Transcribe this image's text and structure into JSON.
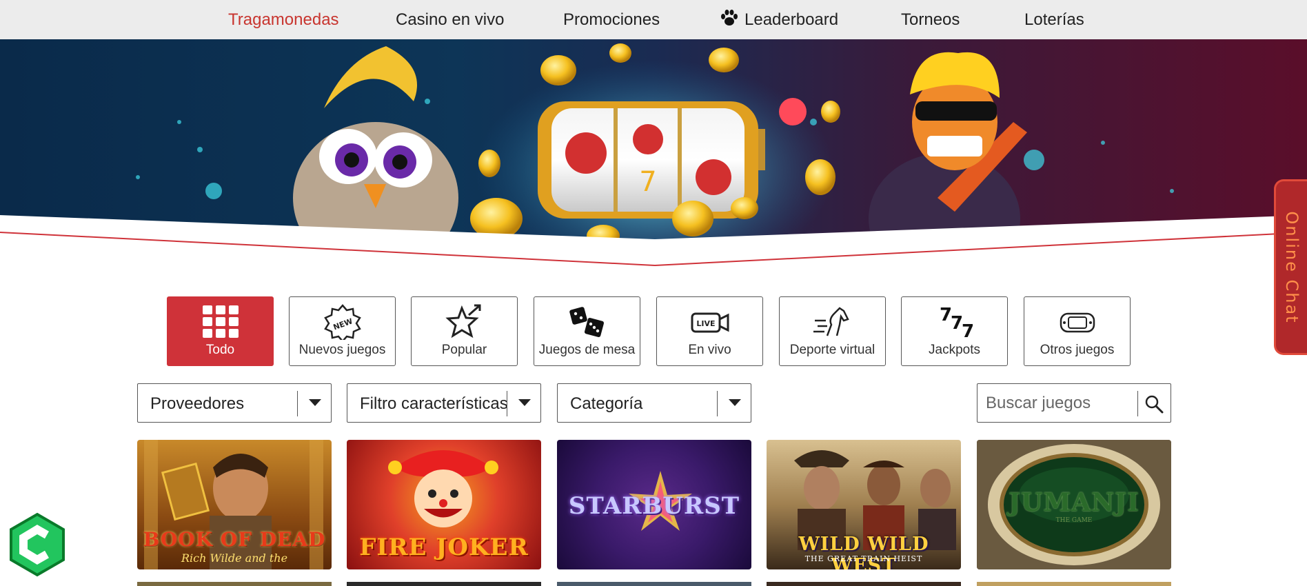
{
  "nav": {
    "items": [
      {
        "label": "Tragamonedas",
        "active": true
      },
      {
        "label": "Casino en vivo",
        "active": false
      },
      {
        "label": "Promociones",
        "active": false
      },
      {
        "label": "Leaderboard",
        "active": false,
        "icon": "paw-icon"
      },
      {
        "label": "Torneos",
        "active": false
      },
      {
        "label": "Loterías",
        "active": false
      }
    ]
  },
  "chat": {
    "label": "Online Chat"
  },
  "categories": [
    {
      "label": "Todo",
      "icon": "grid-icon",
      "active": true
    },
    {
      "label": "Nuevos juegos",
      "icon": "new-badge-icon",
      "active": false
    },
    {
      "label": "Popular",
      "icon": "star-arrow-icon",
      "active": false
    },
    {
      "label": "Juegos de mesa",
      "icon": "dice-icon",
      "active": false
    },
    {
      "label": "En vivo",
      "icon": "live-camera-icon",
      "active": false
    },
    {
      "label": "Deporte virtual",
      "icon": "horse-icon",
      "active": false
    },
    {
      "label": "Jackpots",
      "icon": "sevens-icon",
      "active": false
    },
    {
      "label": "Otros juegos",
      "icon": "gamepad-icon",
      "active": false
    }
  ],
  "filters": {
    "providers": "Proveedores",
    "features": "Filtro características",
    "category": "Categoría"
  },
  "search": {
    "placeholder": "Buscar juegos",
    "value": ""
  },
  "games": [
    {
      "title": "BOOK OF DEAD",
      "subtitle": "Rich Wilde and the"
    },
    {
      "title": "FIRE JOKER",
      "subtitle": ""
    },
    {
      "title": "STARBURST",
      "subtitle": ""
    },
    {
      "title": "WILD WILD WEST",
      "subtitle": "THE GREAT TRAIN HEIST"
    },
    {
      "title": "JUMANJI",
      "subtitle": "THE GAME"
    }
  ],
  "colors": {
    "accent": "#cf3239",
    "nav_bg": "#ececec",
    "chat_bg": "#b0282a",
    "chat_text": "#ff8f4a",
    "logo_green": "#22c55e"
  }
}
